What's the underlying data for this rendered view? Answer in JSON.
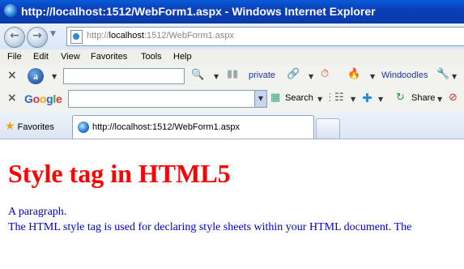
{
  "window": {
    "title": "http://localhost:1512/WebForm1.aspx - Windows Internet Explorer"
  },
  "address_bar": {
    "url_prefix": "http://",
    "url_host": "localhost",
    "url_rest": ":1512/WebForm1.aspx"
  },
  "menu": [
    "File",
    "Edit",
    "View",
    "Favorites",
    "Tools",
    "Help"
  ],
  "toolbar_ask": {
    "search_value": "",
    "private_label": "private",
    "windoodles_label": "Windoodles"
  },
  "toolbar_google": {
    "brand": "Google",
    "search_value": "",
    "search_label": "Search",
    "share_label": "Share"
  },
  "tabs": {
    "favorites_label": "Favorites",
    "active_tab_title": "http://localhost:1512/WebForm1.aspx"
  },
  "page": {
    "heading": "Style tag in HTML5",
    "paragraph_1": "A paragraph.",
    "paragraph_2": "The HTML style tag is used for declaring style sheets within your HTML document. The"
  },
  "colors": {
    "heading": "#ff0000",
    "paragraph": "#0000cc",
    "titlebar": "#0a4fc8"
  }
}
